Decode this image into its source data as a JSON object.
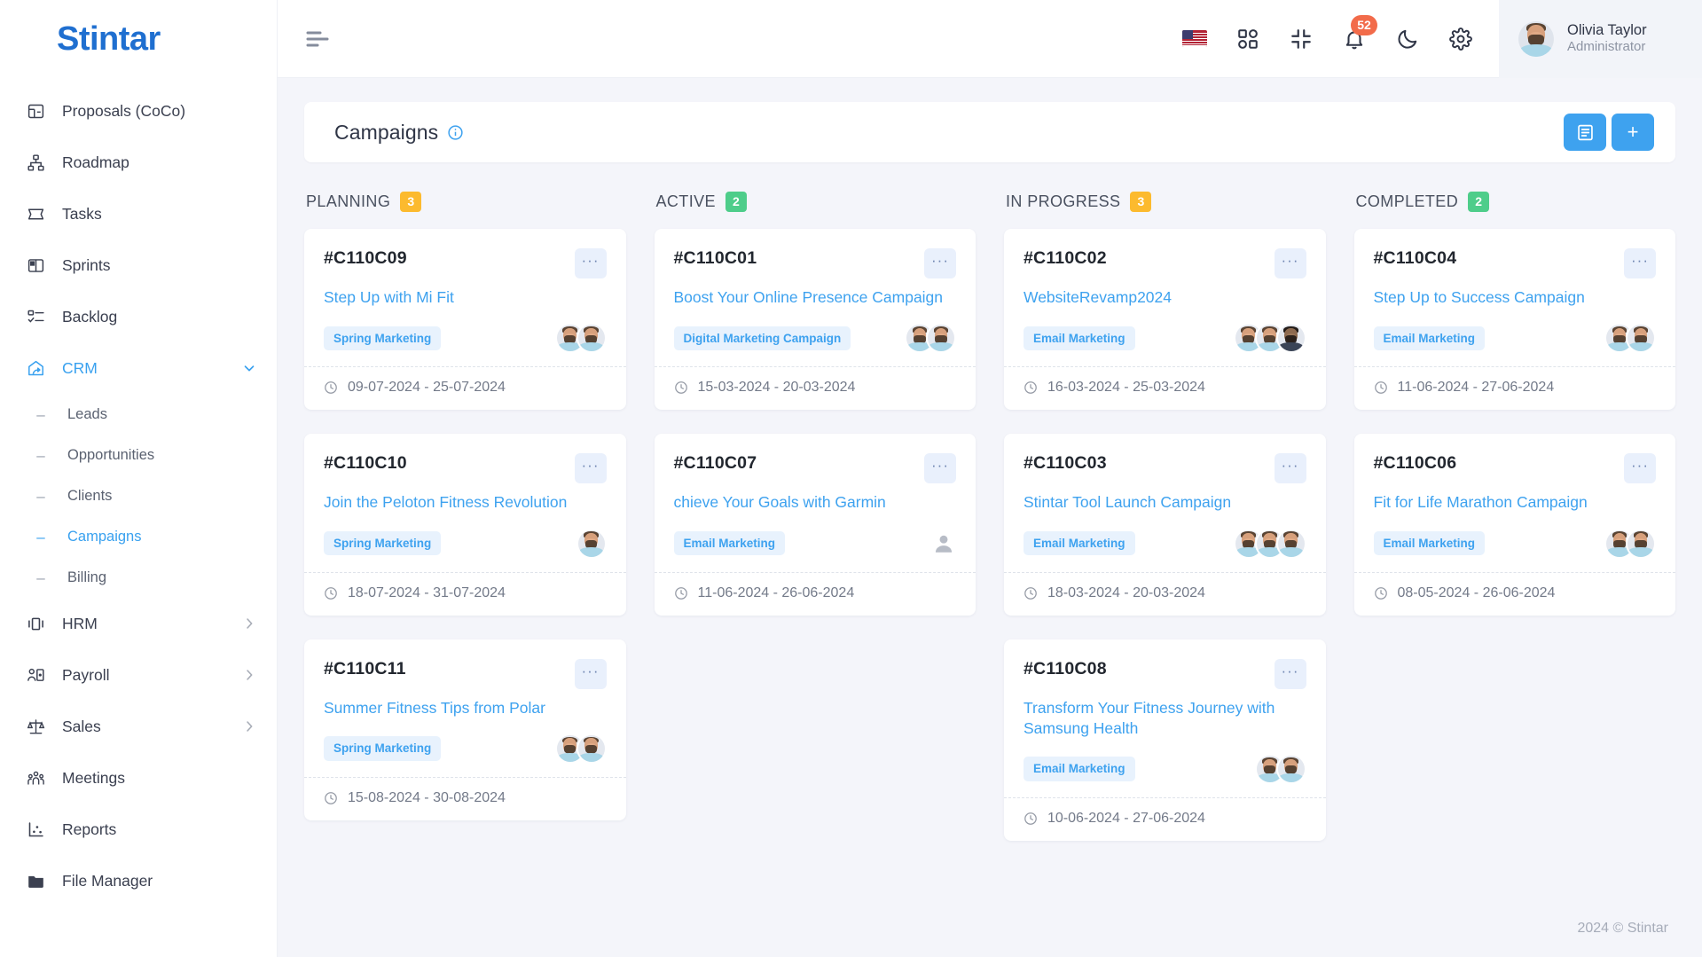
{
  "brand": {
    "name": "Stintar"
  },
  "sidebar": {
    "items": [
      {
        "label": "Proposals (CoCo)",
        "icon": "proposals-icon",
        "active": false,
        "expandable": false
      },
      {
        "label": "Roadmap",
        "icon": "roadmap-icon",
        "active": false,
        "expandable": false
      },
      {
        "label": "Tasks",
        "icon": "tasks-icon",
        "active": false,
        "expandable": false
      },
      {
        "label": "Sprints",
        "icon": "sprints-icon",
        "active": false,
        "expandable": false
      },
      {
        "label": "Backlog",
        "icon": "backlog-icon",
        "active": false,
        "expandable": false
      },
      {
        "label": "CRM",
        "icon": "crm-icon",
        "active": true,
        "expandable": true
      }
    ],
    "crm_children": [
      {
        "label": "Leads",
        "active": false
      },
      {
        "label": "Opportunities",
        "active": false
      },
      {
        "label": "Clients",
        "active": false
      },
      {
        "label": "Campaigns",
        "active": true
      },
      {
        "label": "Billing",
        "active": false
      }
    ],
    "items_after": [
      {
        "label": "HRM",
        "icon": "hrm-icon",
        "active": false,
        "expandable": true
      },
      {
        "label": "Payroll",
        "icon": "payroll-icon",
        "active": false,
        "expandable": true
      },
      {
        "label": "Sales",
        "icon": "sales-icon",
        "active": false,
        "expandable": true
      },
      {
        "label": "Meetings",
        "icon": "meetings-icon",
        "active": false,
        "expandable": false
      },
      {
        "label": "Reports",
        "icon": "reports-icon",
        "active": false,
        "expandable": false
      },
      {
        "label": "File Manager",
        "icon": "file-manager-icon",
        "active": false,
        "expandable": false
      }
    ]
  },
  "topbar": {
    "menu_icon": "hamburger-icon",
    "language_flag": "us-flag-icon",
    "apps_icon": "apps-grid-icon",
    "fullscreen_icon": "collapse-fullscreen-icon",
    "notifications_icon": "bell-icon",
    "notifications_count": "52",
    "dark_mode_icon": "moon-icon",
    "settings_icon": "gear-icon",
    "user": {
      "name": "Olivia Taylor",
      "role": "Administrator",
      "avatar": "user-avatar"
    }
  },
  "page": {
    "title": "Campaigns",
    "info_icon": "info-circle-icon",
    "list_view_button": "list-view-icon",
    "add_button_label": "+"
  },
  "board": {
    "columns": [
      {
        "title": "PLANNING",
        "count": "3",
        "count_color": "#fcba2e",
        "cards": [
          {
            "id": "#C110C09",
            "name": "Step Up with Mi Fit",
            "tag": "Spring Marketing",
            "dates": "09-07-2024 - 25-07-2024",
            "avatars": 2,
            "avatar_styles": [
              "light",
              "light"
            ]
          },
          {
            "id": "#C110C10",
            "name": "Join the Peloton Fitness Revolution",
            "tag": "Spring Marketing",
            "dates": "18-07-2024 - 31-07-2024",
            "avatars": 1,
            "avatar_styles": [
              "light"
            ]
          },
          {
            "id": "#C110C11",
            "name": "Summer Fitness Tips from Polar",
            "tag": "Spring Marketing",
            "dates": "15-08-2024 - 30-08-2024",
            "avatars": 2,
            "avatar_styles": [
              "light",
              "light"
            ]
          }
        ]
      },
      {
        "title": "ACTIVE",
        "count": "2",
        "count_color": "#4ecd8a",
        "cards": [
          {
            "id": "#C110C01",
            "name": "Boost Your Online Presence Campaign",
            "tag": "Digital Marketing Campaign",
            "dates": "15-03-2024 - 20-03-2024",
            "avatars": 2,
            "avatar_styles": [
              "light",
              "light"
            ]
          },
          {
            "id": "#C110C07",
            "name": "chieve Your Goals with Garmin",
            "tag": "Email Marketing",
            "dates": "11-06-2024 - 26-06-2024",
            "avatars": 0,
            "avatar_styles": []
          }
        ]
      },
      {
        "title": "IN PROGRESS",
        "count": "3",
        "count_color": "#fcba2e",
        "cards": [
          {
            "id": "#C110C02",
            "name": "WebsiteRevamp2024",
            "tag": "Email Marketing",
            "dates": "16-03-2024 - 25-03-2024",
            "avatars": 3,
            "avatar_styles": [
              "light",
              "light",
              "dark"
            ]
          },
          {
            "id": "#C110C03",
            "name": "Stintar Tool Launch Campaign",
            "tag": "Email Marketing",
            "dates": "18-03-2024 - 20-03-2024",
            "avatars": 3,
            "avatar_styles": [
              "light",
              "light",
              "light"
            ]
          },
          {
            "id": "#C110C08",
            "name": "Transform Your Fitness Journey with Samsung Health",
            "tag": "Email Marketing",
            "dates": "10-06-2024 - 27-06-2024",
            "avatars": 2,
            "avatar_styles": [
              "light",
              "light"
            ]
          }
        ]
      },
      {
        "title": "COMPLETED",
        "count": "2",
        "count_color": "#4ecd8a",
        "cards": [
          {
            "id": "#C110C04",
            "name": "Step Up to Success Campaign",
            "tag": "Email Marketing",
            "dates": "11-06-2024 - 27-06-2024",
            "avatars": 2,
            "avatar_styles": [
              "light",
              "light"
            ]
          },
          {
            "id": "#C110C06",
            "name": "Fit for Life Marathon Campaign",
            "tag": "Email Marketing",
            "dates": "08-05-2024 - 26-06-2024",
            "avatars": 2,
            "avatar_styles": [
              "light",
              "light"
            ]
          }
        ]
      }
    ],
    "card_menu_label": "···",
    "clock_icon": "clock-icon"
  },
  "footer": {
    "text": "2024 © Stintar"
  },
  "colors": {
    "accent": "#3ea2ef",
    "bg": "#f4f5fa",
    "badge_red": "#f26b4a",
    "yellow": "#fcba2e",
    "green": "#4ecd8a"
  }
}
